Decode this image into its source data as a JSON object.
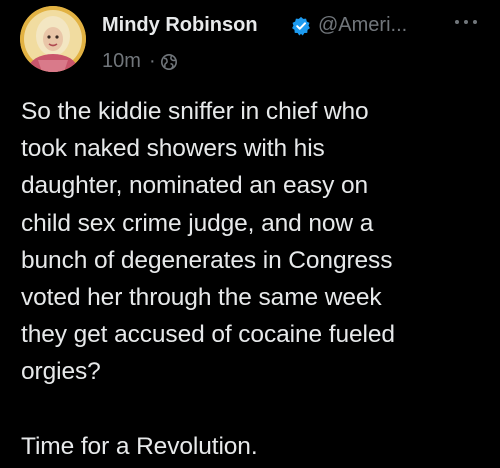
{
  "author": {
    "display_name": "Mindy Robinson",
    "handle": "@Ameri...",
    "verified_icon": "verified-badge-icon",
    "avatar_icon": "avatar"
  },
  "meta": {
    "time": "10m",
    "separator": "·",
    "audience_icon": "globe-icon"
  },
  "menu": {
    "icon": "more-options-icon"
  },
  "post": {
    "text": "So the kiddie sniffer in chief who\ntook naked showers with his\ndaughter, nominated an easy on\nchild sex crime judge, and now a\nbunch of degenerates in Congress\nvoted her through the same week\nthey get accused of cocaine fueled\norgies?\n\nTime for a Revolution."
  },
  "colors": {
    "background": "#000000",
    "primary_text": "#e7e9ea",
    "secondary_text": "#71767b",
    "verified_blue": "#1d9bf0"
  }
}
